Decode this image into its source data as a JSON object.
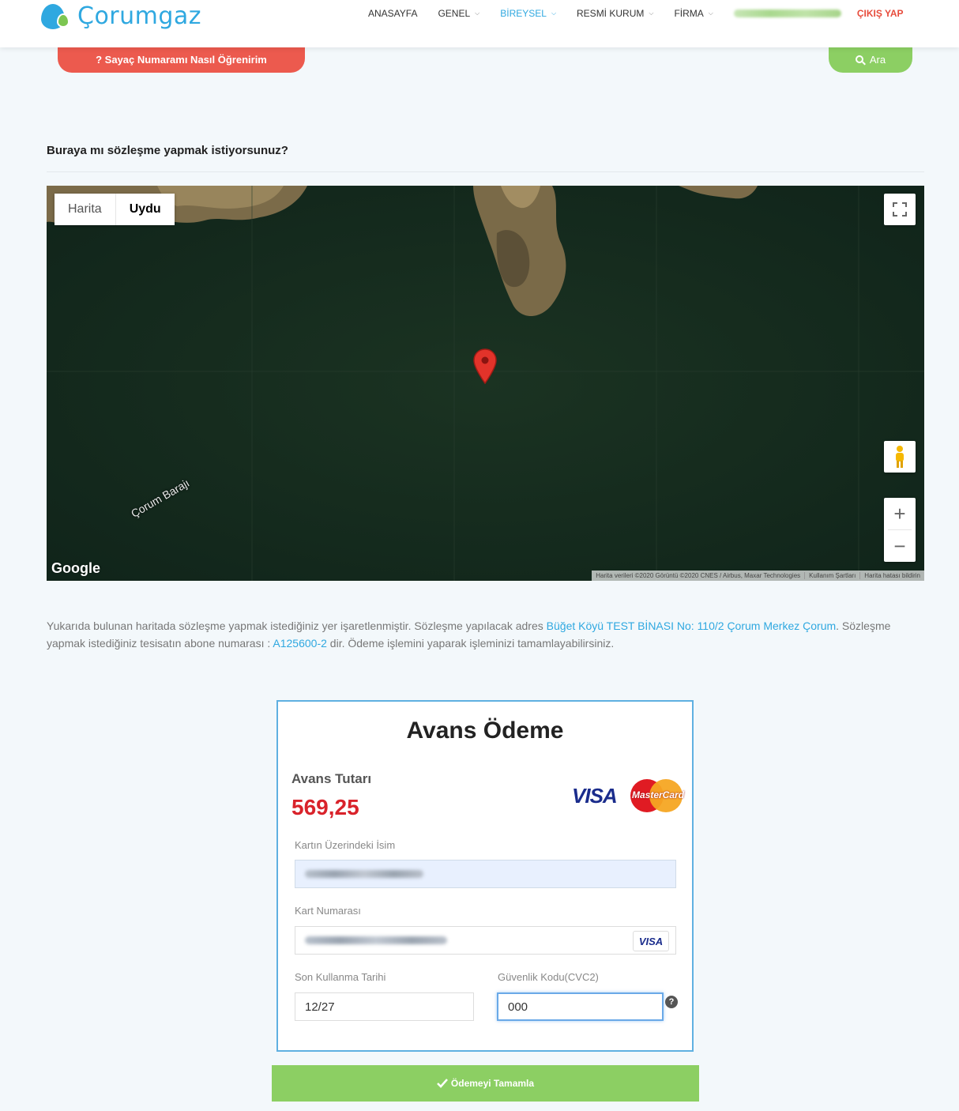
{
  "header": {
    "logo_text": "Çorumgaz",
    "menu": [
      {
        "label": "ANASAYFA",
        "chevron": false,
        "active": false
      },
      {
        "label": "GENEL",
        "chevron": true,
        "active": false
      },
      {
        "label": "BİREYSEL",
        "chevron": true,
        "active": true
      },
      {
        "label": "RESMİ KURUM",
        "chevron": true,
        "active": false
      },
      {
        "label": "FİRMA",
        "chevron": true,
        "active": false
      }
    ],
    "logout_label": "ÇIKIŞ YAP"
  },
  "actions": {
    "howto_label": "? Sayaç Numaramı Nasıl Öğrenirim",
    "search_label": "Ara"
  },
  "question": "Buraya mı sözleşme yapmak istiyorsunuz?",
  "map": {
    "type_map": "Harita",
    "type_satellite": "Uydu",
    "selected": "Uydu",
    "place_label": "Çorum Barajı",
    "google_label": "Google",
    "attribution": [
      "Harita verileri ©2020 Görüntü ©2020 CNES / Airbus, Maxar Technologies",
      "Kullanım Şartları",
      "Harita hatası bildirin"
    ],
    "zoom_in": "+",
    "zoom_out": "−"
  },
  "description": {
    "part1": "Yukarıda bulunan haritada sözleşme yapmak istediğiniz yer işaretlenmiştir. Sözleşme yapılacak adres ",
    "address": "Büğet Köyü TEST BİNASI No: 110/2 Çorum Merkez Çorum",
    "part2": ". Sözleşme yapmak istediğiniz tesisatın abone numarası : ",
    "subscriber": "A125600-2",
    "part3": " dir. Ödeme işlemini yaparak işleminizi tamamlayabilirsiniz."
  },
  "payment": {
    "title": "Avans Ödeme",
    "amount_label": "Avans Tutarı",
    "amount_value": "569,25",
    "visa_label": "VISA",
    "mastercard_label": "MasterCard",
    "card_name_label": "Kartın Üzerindeki İsim",
    "card_number_label": "Kart Numarası",
    "card_number_badge": "VISA",
    "expiry_label": "Son Kullanma Tarihi",
    "expiry_value": "12/27",
    "cvc_label": "Güvenlik Kodu(CVC2)",
    "cvc_value": "000",
    "help_glyph": "?"
  },
  "submit_label": "Ödemeyi Tamamla",
  "colors": {
    "brand_blue": "#2fa8e0",
    "brand_green": "#8ccf63",
    "howto_red": "#ec5a4e",
    "amount_red": "#d9232b"
  }
}
